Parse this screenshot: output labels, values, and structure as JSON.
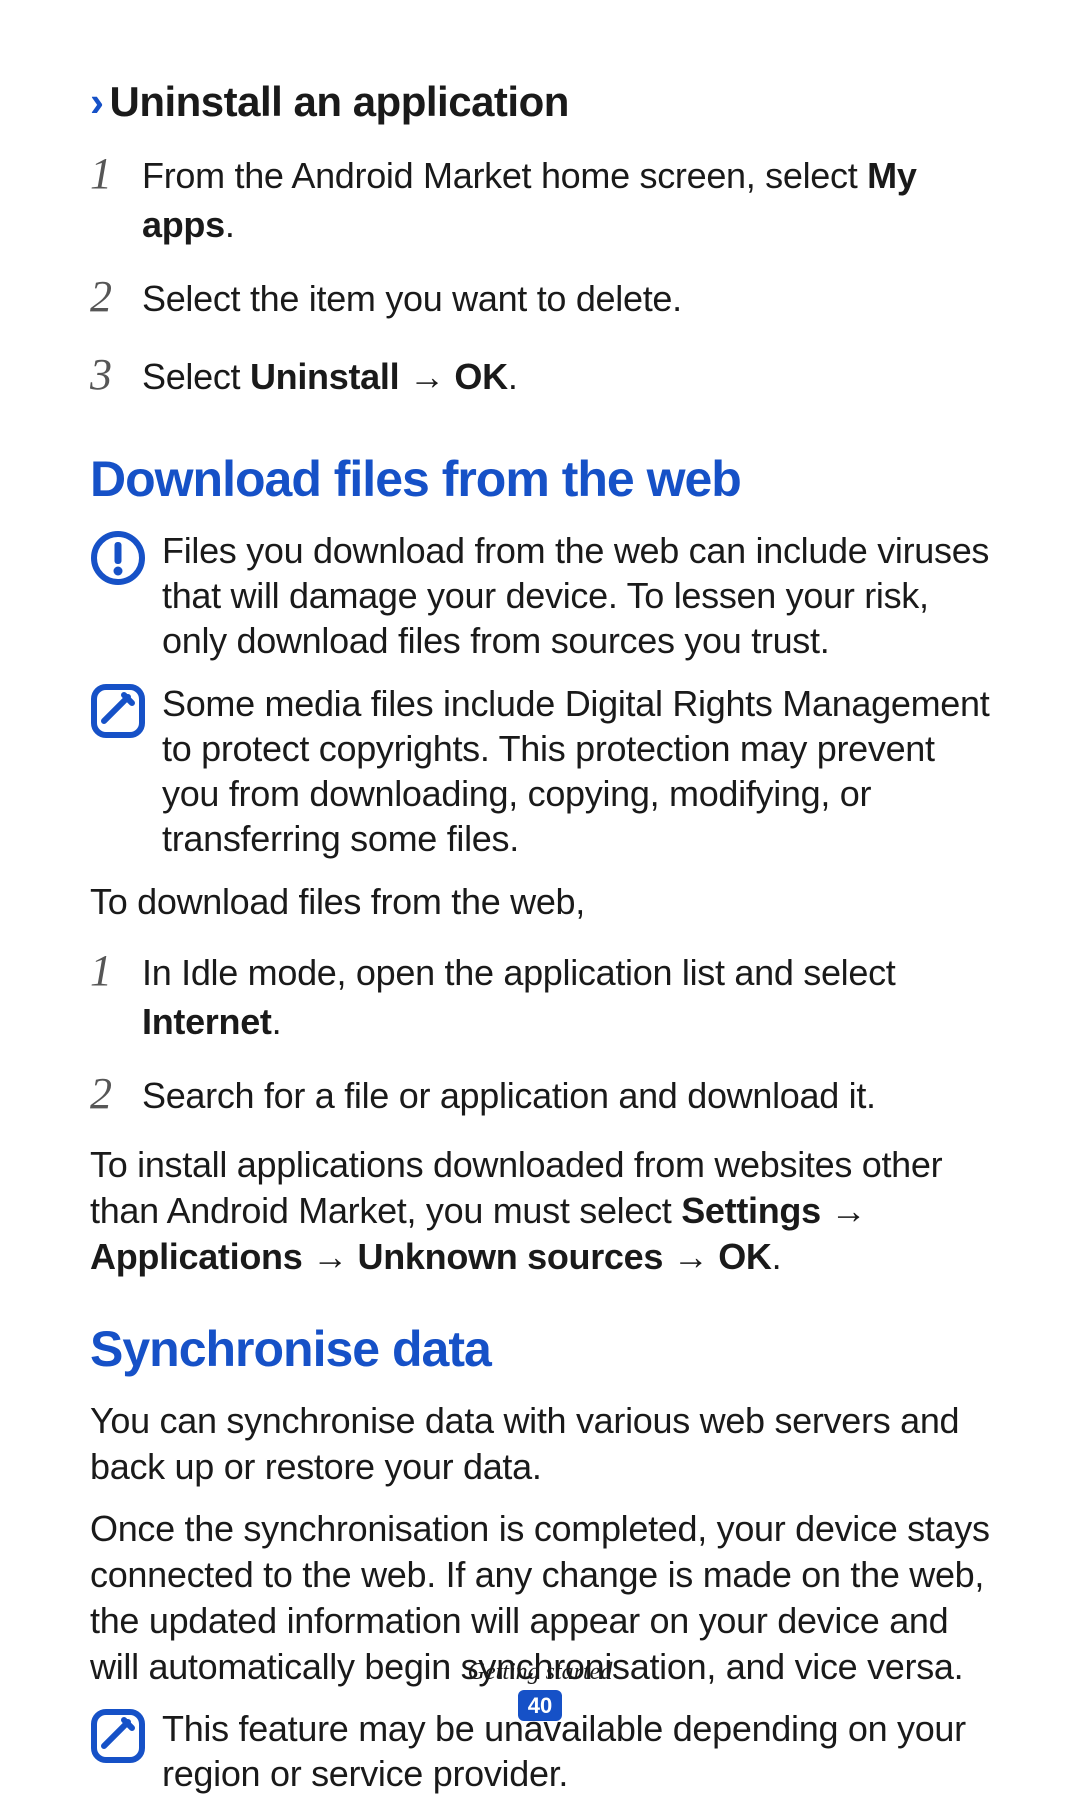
{
  "uninstall": {
    "heading": "Uninstall an application",
    "steps": {
      "s1a": "From the Android Market home screen, select ",
      "s1b": "My apps",
      "s1c": ".",
      "s2": "Select the item you want to delete.",
      "s3a": "Select ",
      "s3b": "Uninstall",
      "s3arrow": " → ",
      "s3c": "OK",
      "s3d": "."
    }
  },
  "download": {
    "heading": "Download files from the web",
    "warn": "Files you download from the web can include viruses that will damage your device. To lessen your risk, only download files from sources you trust.",
    "note": "Some media files include Digital Rights Management to protect copyrights. This protection may prevent you from downloading, copying, modifying, or transferring some files.",
    "intro": "To download files from the web,",
    "steps": {
      "s1a": "In Idle mode, open the application list and select ",
      "s1b": "Internet",
      "s1c": ".",
      "s2": "Search for a file or application and download it."
    },
    "install": {
      "a": "To install applications downloaded from websites other than Android Market, you must select ",
      "b": "Settings",
      "arr1": " → ",
      "c": "Applications",
      "arr2": " → ",
      "d": "Unknown sources",
      "arr3": " → ",
      "e": "OK",
      "f": "."
    }
  },
  "sync": {
    "heading": "Synchronise data",
    "p1": "You can synchronise data with various web servers and back up or restore your data.",
    "p2": "Once the synchronisation is completed, your device stays connected to the web. If any change is made on the web, the updated information will appear on your device and will automatically begin synchronisation, and vice versa.",
    "note": "This feature may be unavailable depending on your region or service provider."
  },
  "footer": {
    "chapter": "Getting started",
    "page": "40"
  },
  "nums": {
    "n1": "1",
    "n2": "2",
    "n3": "3"
  },
  "caret": "›"
}
